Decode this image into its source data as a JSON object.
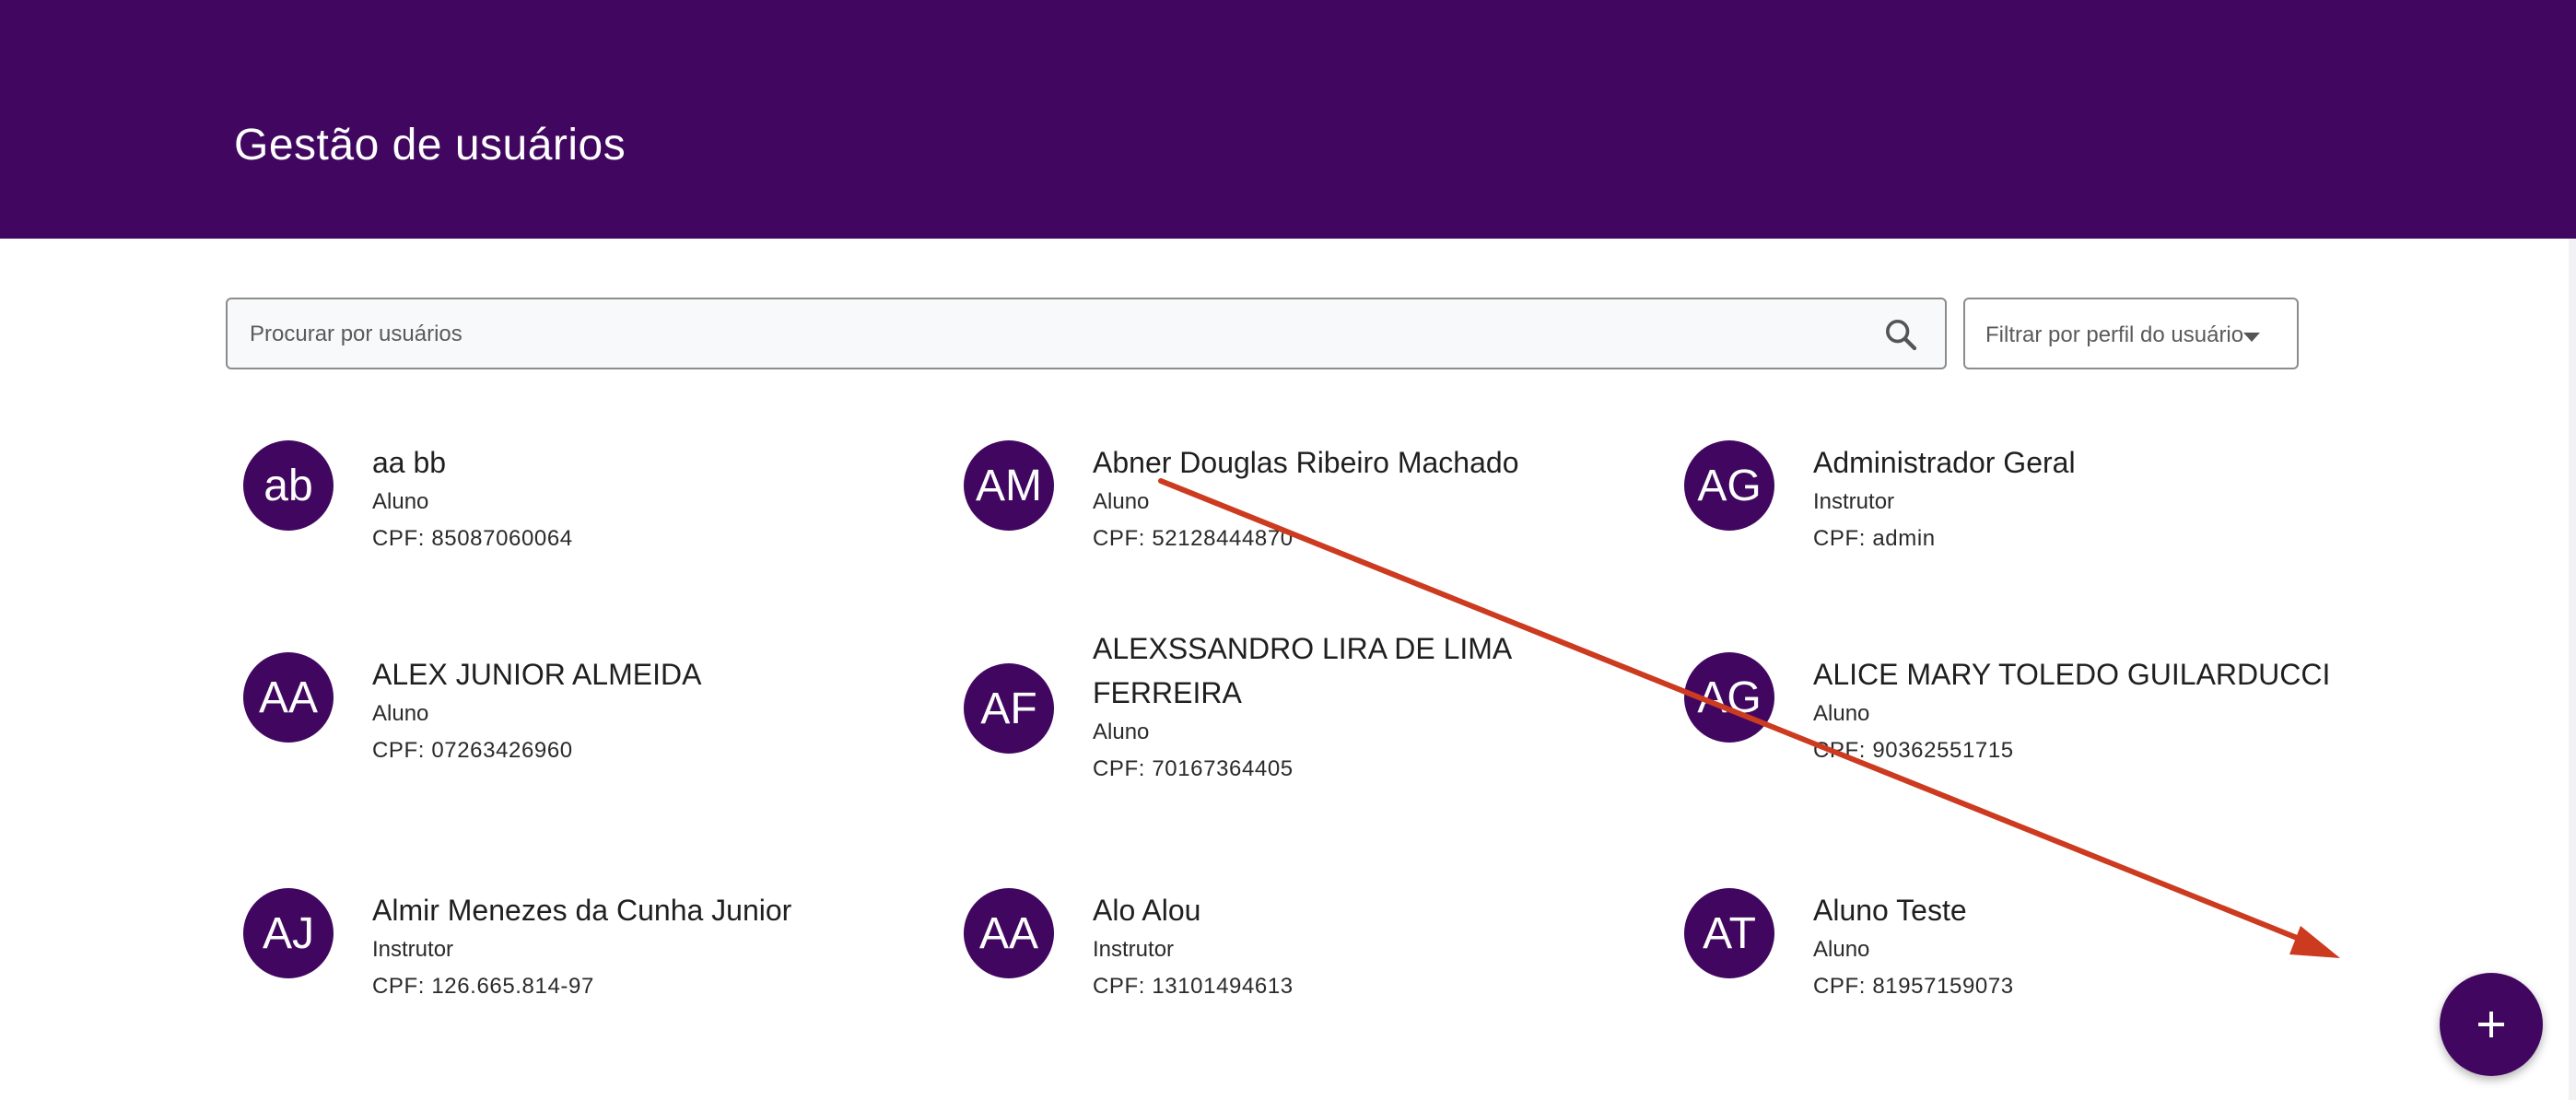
{
  "header": {
    "title": "Gestão de usuários"
  },
  "search": {
    "placeholder": "Procurar por usuários"
  },
  "filter": {
    "label": "Filtrar por perfil do usuário"
  },
  "users": [
    {
      "initials": "ab",
      "name": "aa bb",
      "role": "Aluno",
      "cpf": "CPF: 85087060064"
    },
    {
      "initials": "AM",
      "name": "Abner Douglas Ribeiro Machado",
      "role": "Aluno",
      "cpf": "CPF: 52128444870"
    },
    {
      "initials": "AG",
      "name": "Administrador Geral",
      "role": "Instrutor",
      "cpf": "CPF: admin"
    },
    {
      "initials": "AA",
      "name": "ALEX JUNIOR ALMEIDA",
      "role": "Aluno",
      "cpf": "CPF: 07263426960"
    },
    {
      "initials": "AF",
      "name": "ALEXSSANDRO LIRA DE LIMA FERREIRA",
      "role": "Aluno",
      "cpf": "CPF: 70167364405"
    },
    {
      "initials": "AG",
      "name": "ALICE MARY TOLEDO GUILARDUCCI",
      "role": "Aluno",
      "cpf": "CPF: 90362551715"
    },
    {
      "initials": "AJ",
      "name": "Almir Menezes da Cunha Junior",
      "role": "Instrutor",
      "cpf": "CPF: 126.665.814-97"
    },
    {
      "initials": "AA",
      "name": "Alo Alou",
      "role": "Instrutor",
      "cpf": "CPF: 13101494613"
    },
    {
      "initials": "AT",
      "name": "Aluno Teste",
      "role": "Aluno",
      "cpf": "CPF: 81957159073"
    }
  ],
  "colors": {
    "brand": "#410760",
    "annotation_arrow": "#cc3a1f"
  },
  "icons": {
    "search": "search-icon",
    "caret": "caret-down-icon",
    "add": "plus-icon"
  }
}
